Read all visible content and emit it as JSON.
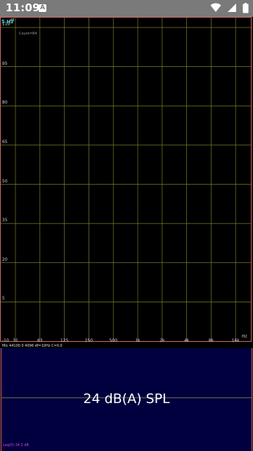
{
  "status_bar": {
    "time": "11:09",
    "notification_icon": "A",
    "icons": [
      "wifi-icon",
      "cellular-signal-icon",
      "battery-icon"
    ]
  },
  "spectrum": {
    "peak_readout": "5 Hz",
    "db_unit": "dB",
    "count_label": "Count=84",
    "y_ticks": [
      "110",
      "95",
      "80",
      "65",
      "50",
      "35",
      "20",
      "5",
      "-10"
    ],
    "x_ticks": [
      "31",
      "63",
      "125",
      "250",
      "500",
      "1k",
      "2k",
      "4k",
      "8k",
      "16k"
    ],
    "x_unit": "Hz"
  },
  "meter": {
    "info_line": "Mic 44100 0 4096 df=10Hz C=0.0",
    "reading": "24 dB(A) SPL",
    "bottom_status": "Leq(0) 24.2 dB"
  },
  "colors": {
    "status_bar_bg": "#7a7a7a",
    "grid": "#7e7e2a",
    "border": "#d46a6a",
    "meter_bg": "#00003e",
    "peak_accent": "#39d0e0",
    "bottom_status": "#e040e0"
  }
}
